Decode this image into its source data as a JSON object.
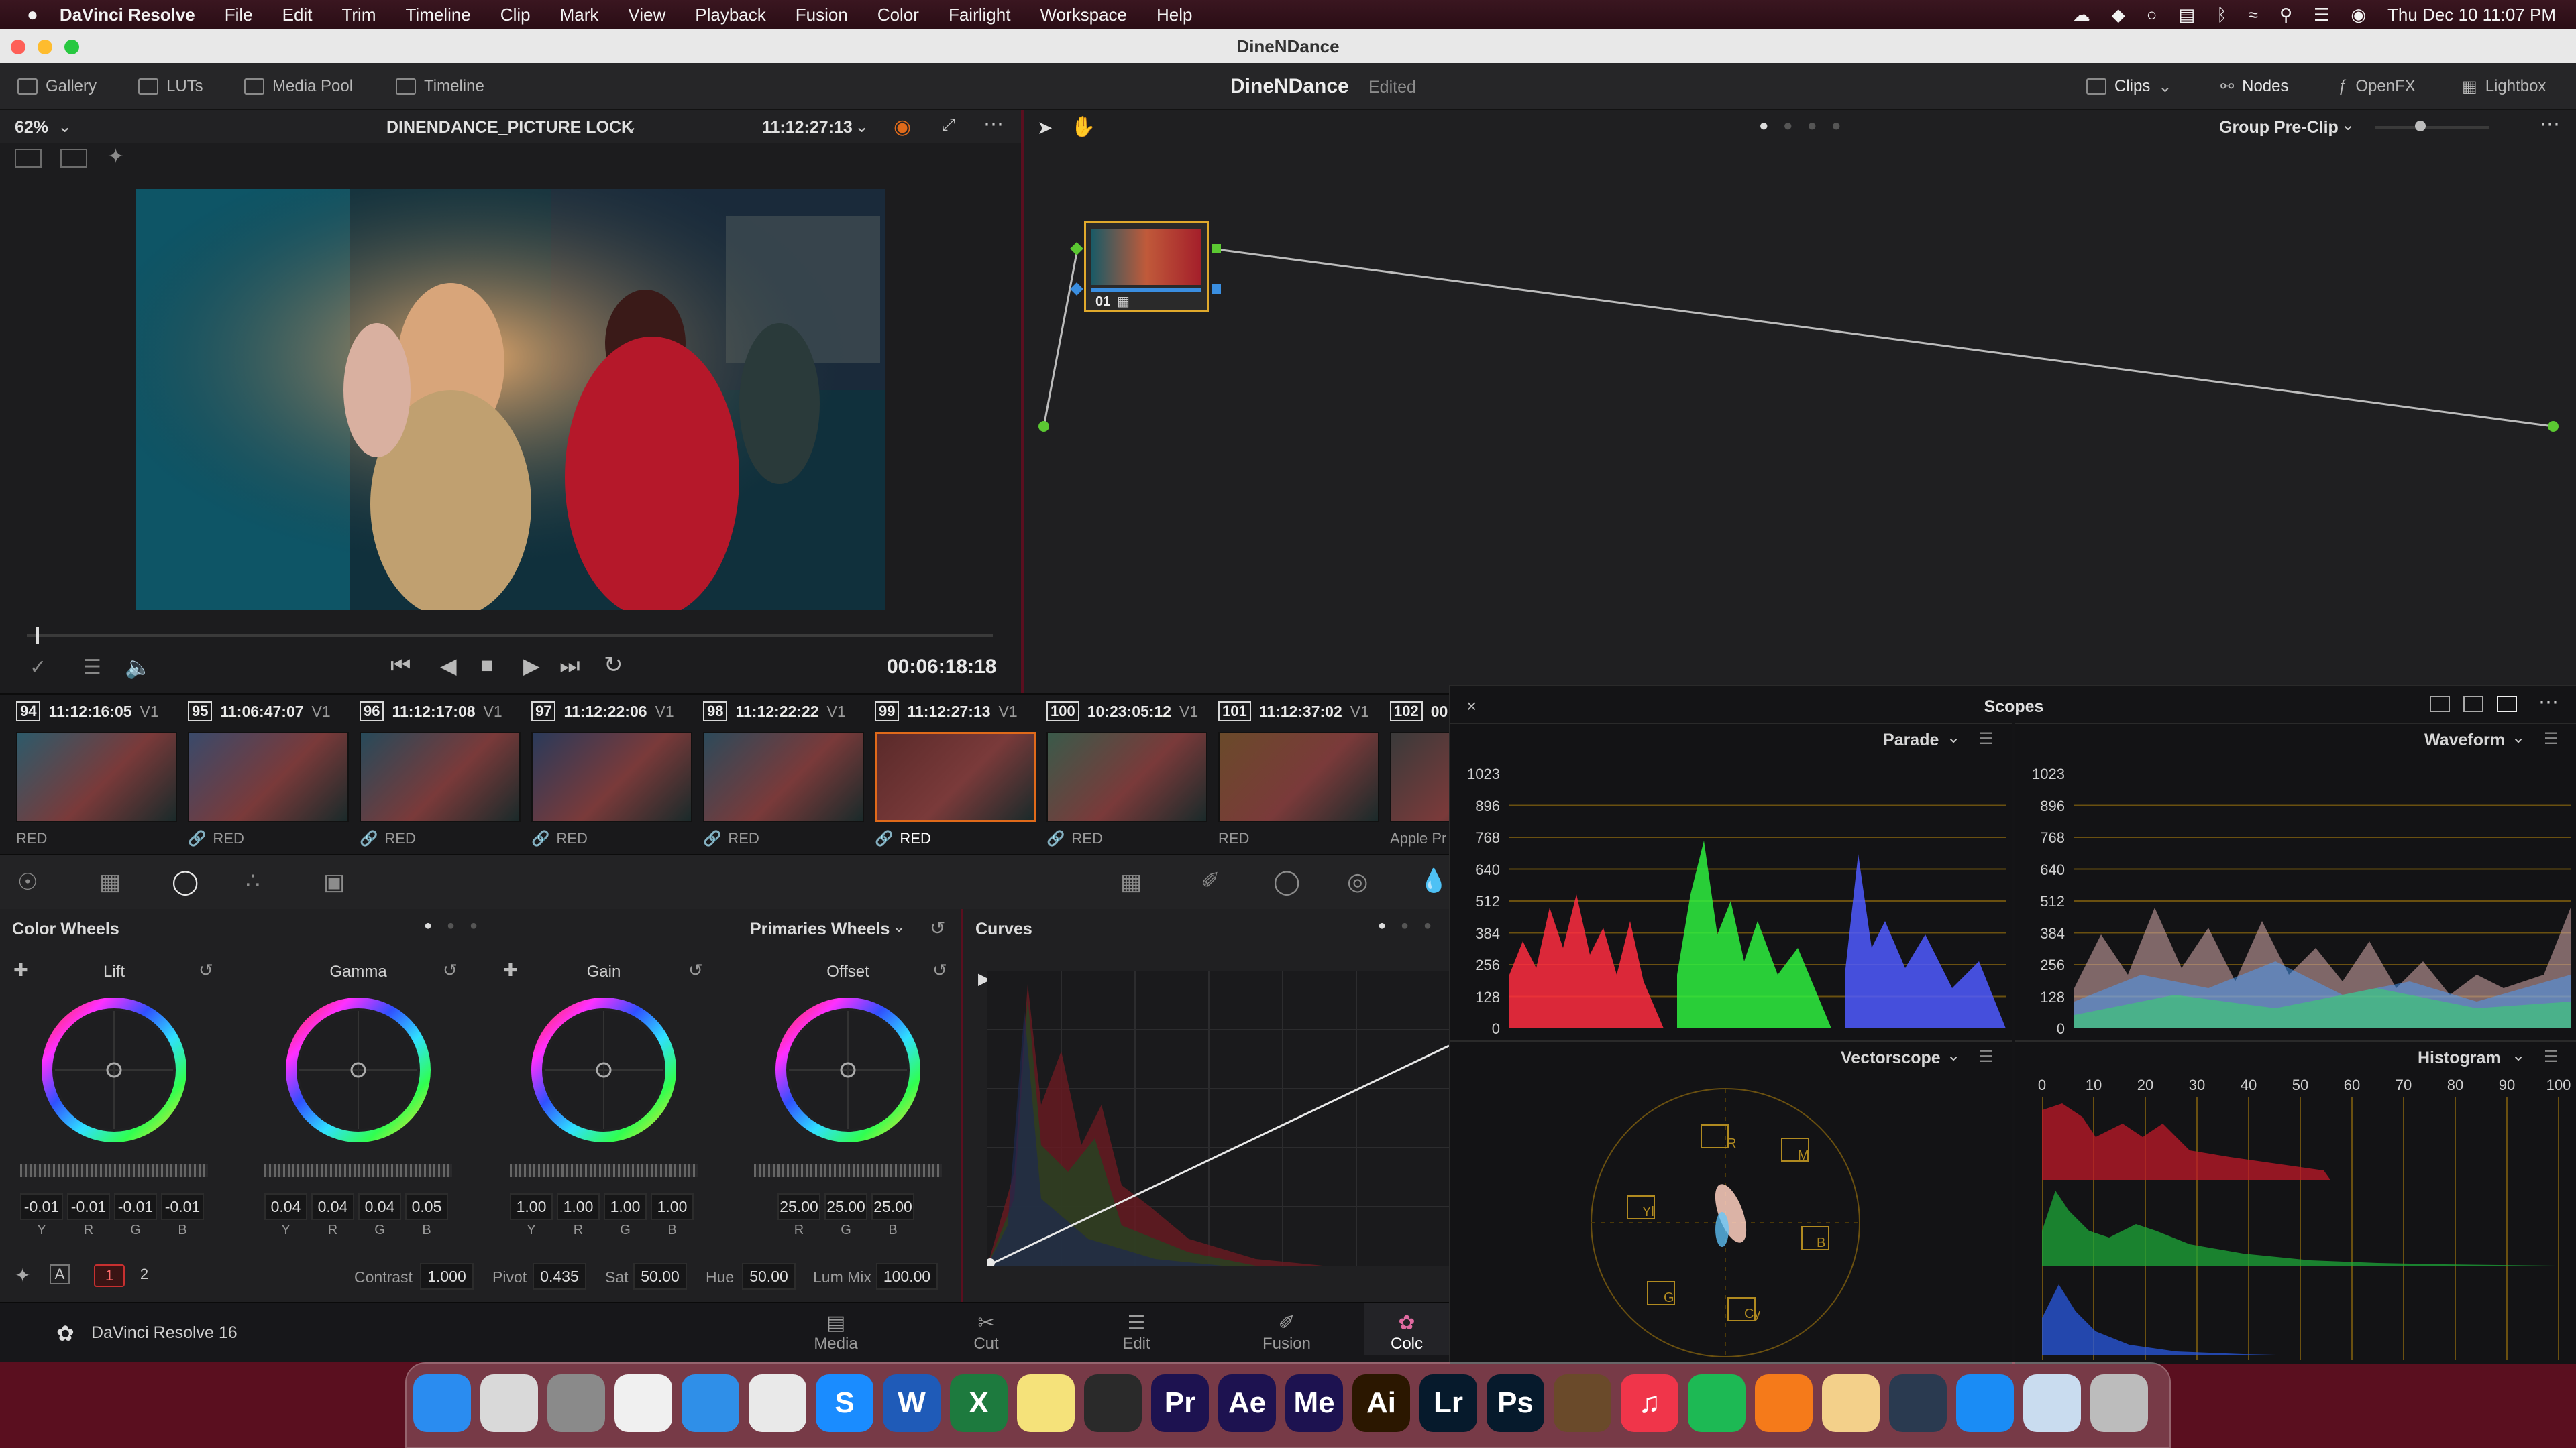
{
  "menubar": {
    "apple_icon": "apple-logo-icon",
    "app_name": "DaVinci Resolve",
    "items": [
      "File",
      "Edit",
      "Trim",
      "Timeline",
      "Clip",
      "Mark",
      "View",
      "Playback",
      "Fusion",
      "Color",
      "Fairlight",
      "Workspace",
      "Help"
    ],
    "datetime": "Thu Dec 10  11:07 PM"
  },
  "window": {
    "title": "DineNDance"
  },
  "toolbar": {
    "gallery": "Gallery",
    "luts": "LUTs",
    "media_pool": "Media Pool",
    "timeline": "Timeline",
    "project_name": "DineNDance",
    "project_status": "Edited",
    "clips": "Clips",
    "nodes": "Nodes",
    "openfx": "OpenFX",
    "lightbox": "Lightbox"
  },
  "viewer": {
    "zoom": "62%",
    "timeline_name": "DINENDANCE_PICTURE LOCK",
    "timecode": "11:12:27:13",
    "playhead_timecode": "00:06:18:18",
    "playhead_progress": 0.01
  },
  "node_editor": {
    "mode": "Group Pre-Clip",
    "node_label": "01",
    "slider_value": 0.4
  },
  "clips": [
    {
      "num": "94",
      "tc": "11:12:16:05",
      "track": "V1",
      "codec": "RED",
      "linked": false,
      "selected": false
    },
    {
      "num": "95",
      "tc": "11:06:47:07",
      "track": "V1",
      "codec": "RED",
      "linked": true,
      "selected": false
    },
    {
      "num": "96",
      "tc": "11:12:17:08",
      "track": "V1",
      "codec": "RED",
      "linked": true,
      "selected": false
    },
    {
      "num": "97",
      "tc": "11:12:22:06",
      "track": "V1",
      "codec": "RED",
      "linked": true,
      "selected": false
    },
    {
      "num": "98",
      "tc": "11:12:22:22",
      "track": "V1",
      "codec": "RED",
      "linked": true,
      "selected": false
    },
    {
      "num": "99",
      "tc": "11:12:27:13",
      "track": "V1",
      "codec": "RED",
      "linked": true,
      "selected": true
    },
    {
      "num": "100",
      "tc": "10:23:05:12",
      "track": "V1",
      "codec": "RED",
      "linked": true,
      "selected": false
    },
    {
      "num": "101",
      "tc": "11:12:37:02",
      "track": "V1",
      "codec": "RED",
      "linked": false,
      "selected": false
    },
    {
      "num": "102",
      "tc": "00:",
      "track": "",
      "codec": "Apple Pr",
      "linked": false,
      "selected": false
    }
  ],
  "color_wheels": {
    "title": "Color Wheels",
    "mode": "Primaries Wheels",
    "wheels": [
      {
        "name": "Lift",
        "labels": [
          "Y",
          "R",
          "G",
          "B"
        ],
        "values": [
          "-0.01",
          "-0.01",
          "-0.01",
          "-0.01"
        ]
      },
      {
        "name": "Gamma",
        "labels": [
          "Y",
          "R",
          "G",
          "B"
        ],
        "values": [
          "0.04",
          "0.04",
          "0.04",
          "0.05"
        ]
      },
      {
        "name": "Gain",
        "labels": [
          "Y",
          "R",
          "G",
          "B"
        ],
        "values": [
          "1.00",
          "1.00",
          "1.00",
          "1.00"
        ]
      },
      {
        "name": "Offset",
        "labels": [
          "R",
          "G",
          "B"
        ],
        "values": [
          "25.00",
          "25.00",
          "25.00"
        ]
      }
    ],
    "page1": "1",
    "page2": "2",
    "a_label": "A",
    "contrast_label": "Contrast",
    "contrast": "1.000",
    "pivot_label": "Pivot",
    "pivot": "0.435",
    "sat_label": "Sat",
    "sat": "50.00",
    "hue_label": "Hue",
    "hue": "50.00",
    "lummix_label": "Lum Mix",
    "lummix": "100.00"
  },
  "curves": {
    "title": "Curves"
  },
  "pages": {
    "app_label": "DaVinci Resolve 16",
    "tabs": [
      "Media",
      "Cut",
      "Edit",
      "Fusion",
      "Colc"
    ]
  },
  "scopes": {
    "title": "Scopes",
    "parade": "Parade",
    "waveform": "Waveform",
    "vectorscope": "Vectorscope",
    "histogram": "Histogram",
    "y_ticks": [
      "1023",
      "896",
      "768",
      "640",
      "512",
      "384",
      "256",
      "128",
      "0"
    ],
    "hist_ticks": [
      "0",
      "10",
      "20",
      "30",
      "40",
      "50",
      "60",
      "70",
      "80",
      "90",
      "100"
    ],
    "vector_targets": [
      "R",
      "M",
      "B",
      "Cy",
      "G",
      "Yl"
    ]
  },
  "dock": {
    "apps": [
      {
        "name": "Finder",
        "icon": "finder-icon",
        "color": "#2a8cf0",
        "glyph": ""
      },
      {
        "name": "Launchpad",
        "icon": "launchpad-icon",
        "color": "#d9d9d9",
        "glyph": ""
      },
      {
        "name": "System Preferences",
        "icon": "gear-icon",
        "color": "#8a8a8a",
        "glyph": ""
      },
      {
        "name": "DaVinci Dictionary",
        "icon": "dictionary-icon",
        "color": "#f0f0f0",
        "glyph": ""
      },
      {
        "name": "Safari",
        "icon": "safari-icon",
        "color": "#2f8fe8",
        "glyph": ""
      },
      {
        "name": "Chrome",
        "icon": "chrome-icon",
        "color": "#e9e9e9",
        "glyph": ""
      },
      {
        "name": "Shazam",
        "icon": "shazam-icon",
        "color": "#1a8cff",
        "glyph": "S"
      },
      {
        "name": "Word",
        "icon": "word-icon",
        "color": "#1f5bb8",
        "glyph": "W"
      },
      {
        "name": "Excel",
        "icon": "excel-icon",
        "color": "#1d7a3e",
        "glyph": "X"
      },
      {
        "name": "Notes",
        "icon": "notes-icon",
        "color": "#f5e27a",
        "glyph": ""
      },
      {
        "name": "DaVinci Resolve",
        "icon": "resolve-icon",
        "color": "#2a2a2a",
        "glyph": ""
      },
      {
        "name": "Premiere Pro",
        "icon": "premiere-icon",
        "color": "#1d1250",
        "glyph": "Pr"
      },
      {
        "name": "After Effects",
        "icon": "after-effects-icon",
        "color": "#1d1250",
        "glyph": "Ae"
      },
      {
        "name": "Media Encoder",
        "icon": "media-encoder-icon",
        "color": "#1d1250",
        "glyph": "Me"
      },
      {
        "name": "Illustrator",
        "icon": "illustrator-icon",
        "color": "#2b1700",
        "glyph": "Ai"
      },
      {
        "name": "Lightroom",
        "icon": "lightroom-icon",
        "color": "#061a2c",
        "glyph": "Lr"
      },
      {
        "name": "Photoshop",
        "icon": "photoshop-icon",
        "color": "#061a2c",
        "glyph": "Ps"
      },
      {
        "name": "GarageBand",
        "icon": "garageband-icon",
        "color": "#6a4a2a",
        "glyph": ""
      },
      {
        "name": "Music",
        "icon": "music-icon",
        "color": "#f0354a",
        "glyph": "♫"
      },
      {
        "name": "Spotify",
        "icon": "spotify-icon",
        "color": "#1db954",
        "glyph": ""
      },
      {
        "name": "Overcast",
        "icon": "overcast-icon",
        "color": "#f57a1a",
        "glyph": ""
      },
      {
        "name": "Stickies",
        "icon": "stickies-icon",
        "color": "#f3d08a",
        "glyph": ""
      },
      {
        "name": "QuickTime",
        "icon": "quicktime-icon",
        "color": "#2a3a50",
        "glyph": ""
      },
      {
        "name": "App Store",
        "icon": "app-store-icon",
        "color": "#1a8cf5",
        "glyph": ""
      },
      {
        "name": "Preview",
        "icon": "preview-icon",
        "color": "#c9dcef",
        "glyph": ""
      },
      {
        "name": "Trash",
        "icon": "trash-icon",
        "color": "#bcbcbc",
        "glyph": ""
      }
    ]
  },
  "colors": {
    "accent_orange": "#e0661e",
    "node_border": "#e0a92c",
    "selected_clip": "#e06a1a",
    "scope_red": "#ff2d40",
    "scope_green": "#2ef03e",
    "scope_blue": "#4f5bff"
  }
}
